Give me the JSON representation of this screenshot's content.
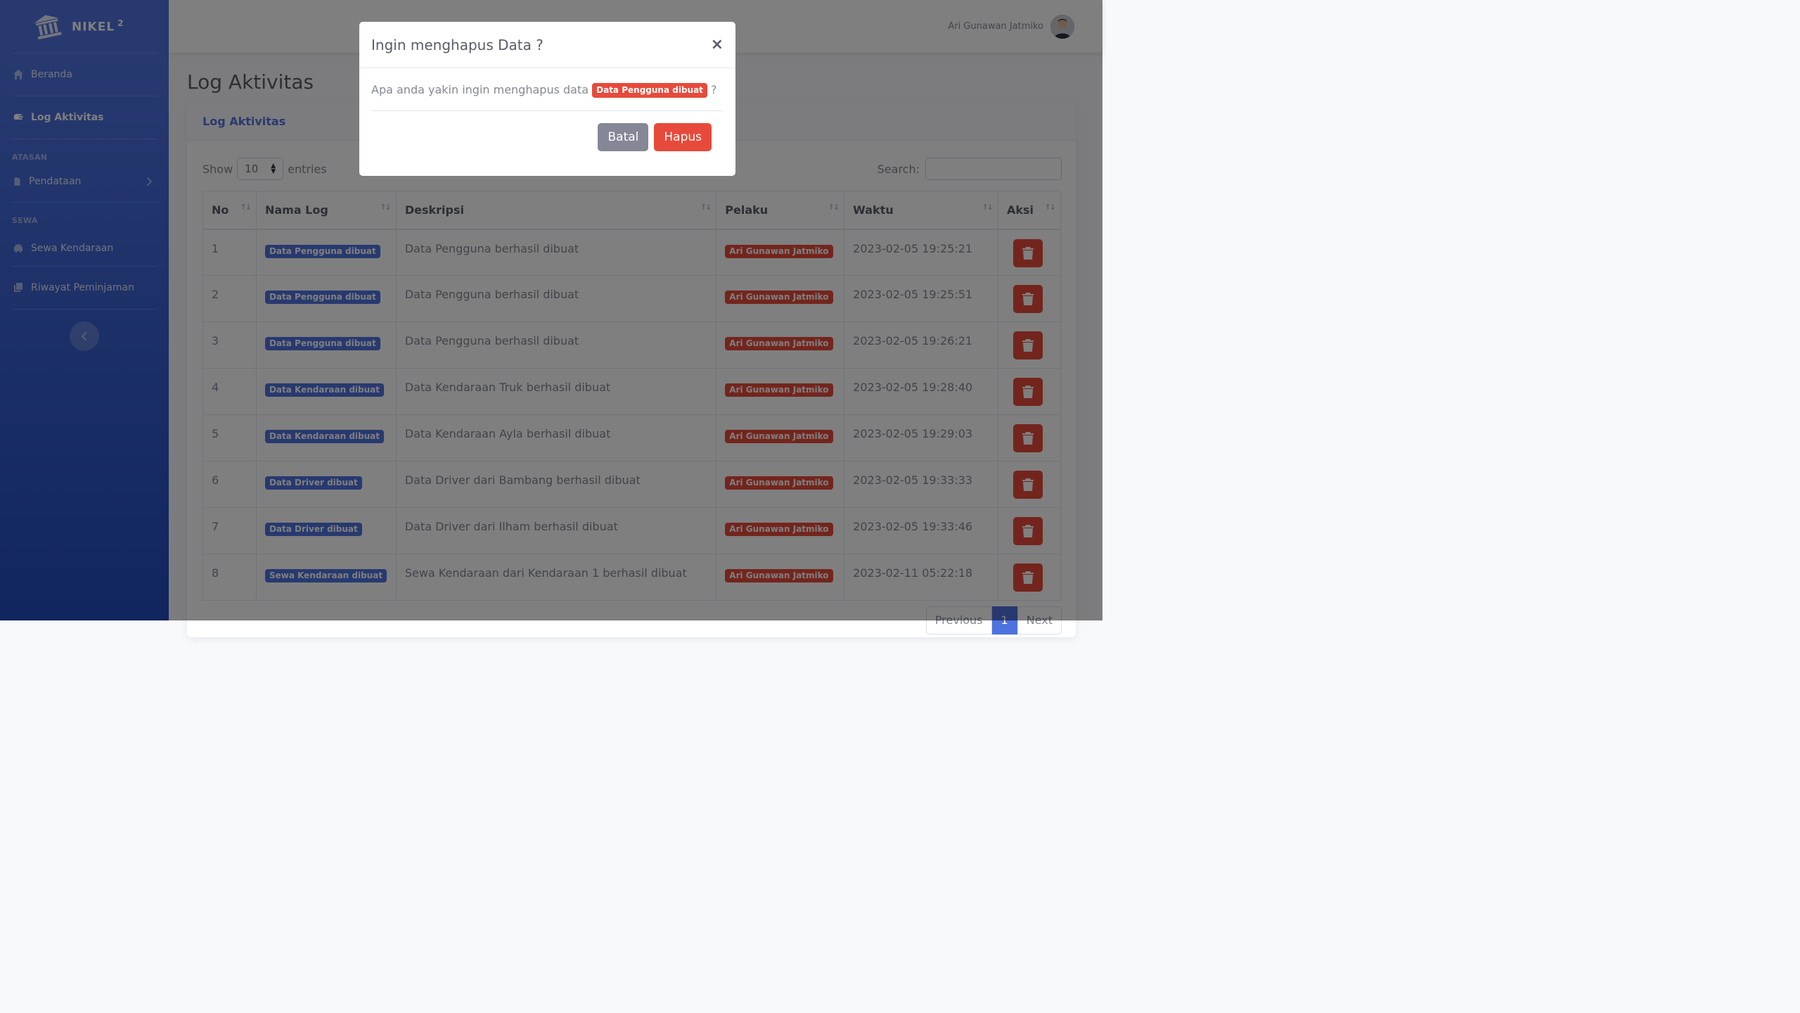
{
  "brand": {
    "name": "NIKEL",
    "sup": "2"
  },
  "sidebar": {
    "items": [
      {
        "label": "Beranda"
      },
      {
        "label": "Log Aktivitas"
      }
    ],
    "heading_atasan": "ATASAN",
    "pendataan": "Pendataan",
    "heading_sewa": "SEWA",
    "sewa_items": [
      {
        "label": "Sewa Kendaraan"
      },
      {
        "label": "Riwayat Peminjaman"
      }
    ]
  },
  "topbar": {
    "user_name": "Ari Gunawan Jatmiko"
  },
  "page": {
    "title": "Log Aktivitas"
  },
  "card": {
    "title": "Log Aktivitas",
    "show_label": "Show",
    "show_value": "10",
    "entries_label": "entries",
    "search_label": "Search:"
  },
  "table": {
    "headers": [
      "No",
      "Nama Log",
      "Deskripsi",
      "Pelaku",
      "Waktu",
      "Aksi"
    ],
    "rows": [
      {
        "no": "1",
        "nama": "Data Pengguna dibuat",
        "desk": "Data Pengguna berhasil dibuat",
        "pelaku": "Ari Gunawan Jatmiko",
        "waktu": "2023-02-05 19:25:21"
      },
      {
        "no": "2",
        "nama": "Data Pengguna dibuat",
        "desk": "Data Pengguna berhasil dibuat",
        "pelaku": "Ari Gunawan Jatmiko",
        "waktu": "2023-02-05 19:25:51"
      },
      {
        "no": "3",
        "nama": "Data Pengguna dibuat",
        "desk": "Data Pengguna berhasil dibuat",
        "pelaku": "Ari Gunawan Jatmiko",
        "waktu": "2023-02-05 19:26:21"
      },
      {
        "no": "4",
        "nama": "Data Kendaraan dibuat",
        "desk": "Data Kendaraan Truk berhasil dibuat",
        "pelaku": "Ari Gunawan Jatmiko",
        "waktu": "2023-02-05 19:28:40"
      },
      {
        "no": "5",
        "nama": "Data Kendaraan dibuat",
        "desk": "Data Kendaraan Ayla berhasil dibuat",
        "pelaku": "Ari Gunawan Jatmiko",
        "waktu": "2023-02-05 19:29:03"
      },
      {
        "no": "6",
        "nama": "Data Driver dibuat",
        "desk": "Data Driver dari Bambang berhasil dibuat",
        "pelaku": "Ari Gunawan Jatmiko",
        "waktu": "2023-02-05 19:33:33"
      },
      {
        "no": "7",
        "nama": "Data Driver dibuat",
        "desk": "Data Driver dari Ilham berhasil dibuat",
        "pelaku": "Ari Gunawan Jatmiko",
        "waktu": "2023-02-05 19:33:46"
      },
      {
        "no": "8",
        "nama": "Sewa Kendaraan dibuat",
        "desk": "Sewa Kendaraan dari Kendaraan 1 berhasil dibuat",
        "pelaku": "Ari Gunawan Jatmiko",
        "waktu": "2023-02-11 05:22:18"
      }
    ]
  },
  "pager": {
    "prev": "Previous",
    "current": "1",
    "next": "Next"
  },
  "modal": {
    "title": "Ingin menghapus Data ?",
    "close": "×",
    "body_prefix": "Apa anda yakin ingin menghapus data",
    "target_badge": "Data Pengguna dibuat",
    "body_suffix": "?",
    "cancel": "Batal",
    "confirm": "Hapus"
  },
  "colors": {
    "primary": "#4e73df",
    "danger": "#e74a3b",
    "secondary": "#858796"
  },
  "icons": [
    "university-icon",
    "home-icon",
    "hand-icon",
    "file-icon",
    "chevron-right-icon",
    "car-icon",
    "copy-icon",
    "chevron-left-icon",
    "trash-icon",
    "close-icon"
  ]
}
